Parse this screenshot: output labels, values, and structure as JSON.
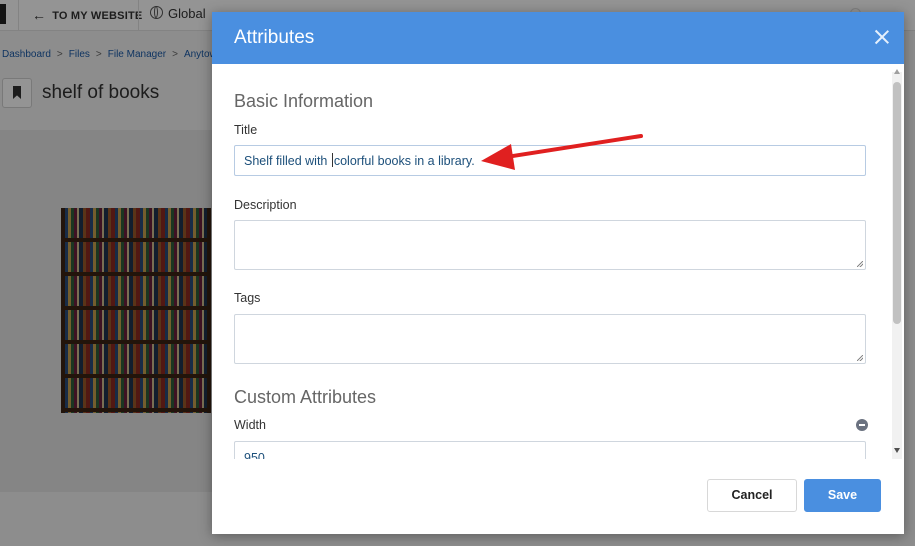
{
  "topbar": {
    "back_label": "TO MY WEBSITE",
    "global_label": "Global"
  },
  "breadcrumb": [
    "Dashboard",
    "Files",
    "File Manager",
    "Anytow"
  ],
  "page": {
    "title": "shelf of books"
  },
  "modal": {
    "title": "Attributes",
    "basic_section": "Basic Information",
    "title_label": "Title",
    "title_value_before_caret": "Shelf filled with ",
    "title_value_after_caret": "colorful books in a library.",
    "description_label": "Description",
    "tags_label": "Tags",
    "custom_section": "Custom Attributes",
    "width_label": "Width",
    "width_value": "950",
    "cancel_label": "Cancel",
    "save_label": "Save"
  },
  "colors": {
    "header": "#4a8fe0",
    "save_button": "#4a8fe0",
    "annotation_arrow": "#e02020"
  },
  "icons": [
    "back-arrow-icon",
    "globe-icon",
    "search-icon",
    "bookmark-icon",
    "close-icon",
    "remove-icon",
    "resize-grip-icon"
  ]
}
